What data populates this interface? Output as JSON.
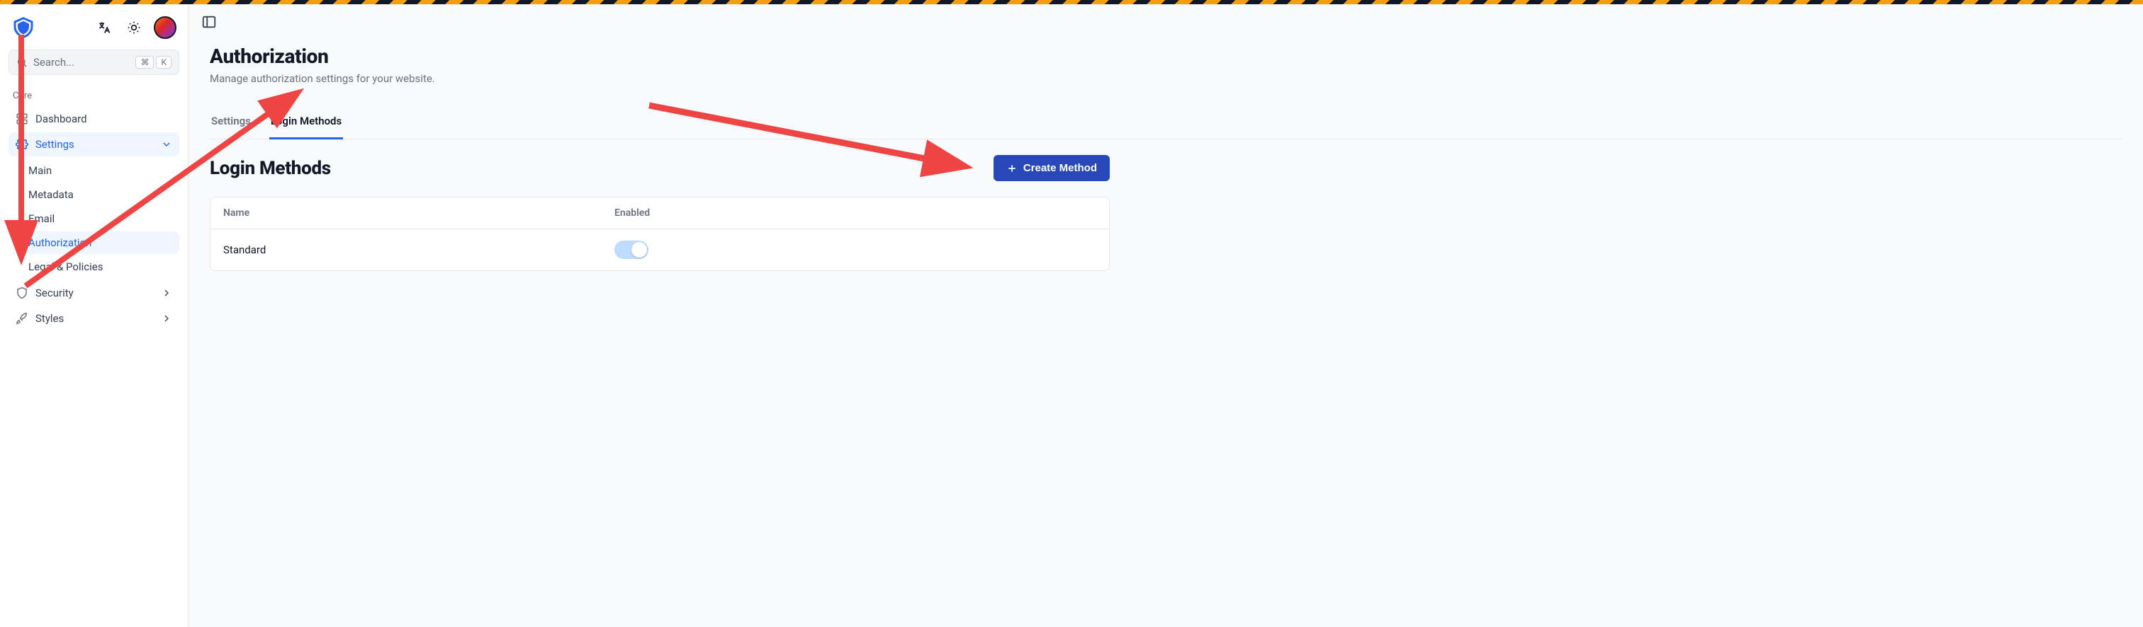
{
  "search": {
    "placeholder": "Search...",
    "kbd1": "⌘",
    "kbd2": "K"
  },
  "sidebar": {
    "section_label": "Core",
    "dashboard": "Dashboard",
    "settings": "Settings",
    "settings_children": {
      "main": "Main",
      "metadata": "Metadata",
      "email": "Email",
      "authorization": "Authorization",
      "legal": "Legal & Policies"
    },
    "security": "Security",
    "styles": "Styles"
  },
  "page": {
    "title": "Authorization",
    "subtitle": "Manage authorization settings for your website."
  },
  "tabs": {
    "settings": "Settings",
    "login_methods": "Login Methods"
  },
  "section": {
    "title": "Login Methods",
    "create_button": "Create Method"
  },
  "table": {
    "headers": {
      "name": "Name",
      "enabled": "Enabled"
    },
    "rows": [
      {
        "name": "Standard",
        "enabled": true
      }
    ]
  },
  "colors": {
    "accent": "#2563eb",
    "button": "#2948b8"
  }
}
